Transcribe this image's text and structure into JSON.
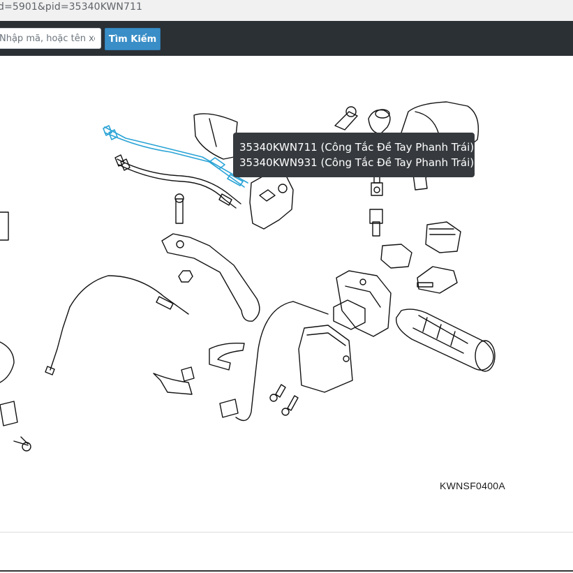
{
  "browser": {
    "url": "d=5901&pid=35340KWN711"
  },
  "search": {
    "placeholder": "Nhập mã, hoặc tên xe ...",
    "button_label": "Tìm Kiếm"
  },
  "tooltip": {
    "lines": [
      "35340KWN711 (Công Tắc Đề Tay Phanh Trái)",
      "35340KWN931 (Công Tắc Đề Tay Phanh Trái)"
    ]
  },
  "diagram": {
    "code": "KWNSF0400A",
    "highlight_color": "#29a3d6"
  }
}
